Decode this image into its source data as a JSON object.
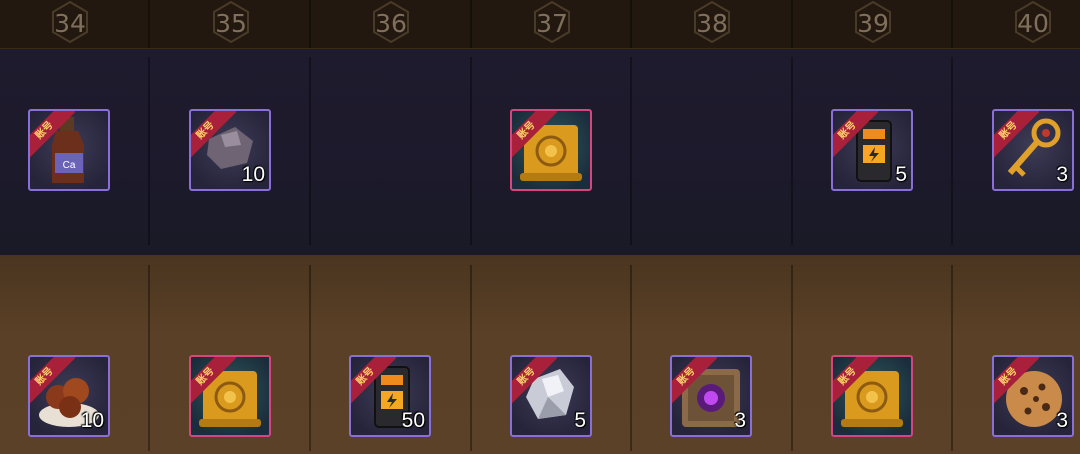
{
  "levels": [
    "34",
    "35",
    "36",
    "37",
    "38",
    "39",
    "40"
  ],
  "ribbon_text": "账号",
  "free_row": [
    {
      "col": 0,
      "icon": "soda-bottle-icon",
      "quantity": ""
    },
    {
      "col": 1,
      "icon": "ore-chunk-icon",
      "quantity": "10"
    },
    {
      "col": 3,
      "icon": "gold-scroll-icon",
      "quantity": ""
    },
    {
      "col": 5,
      "icon": "battery-device-icon",
      "quantity": "5"
    },
    {
      "col": 6,
      "icon": "golden-key-icon",
      "quantity": "3"
    }
  ],
  "paid_row": [
    {
      "col": 0,
      "icon": "meat-platter-icon",
      "quantity": "10"
    },
    {
      "col": 1,
      "icon": "gold-scroll-icon",
      "quantity": ""
    },
    {
      "col": 2,
      "icon": "battery-device-icon",
      "quantity": "50"
    },
    {
      "col": 3,
      "icon": "crystal-gem-icon",
      "quantity": "5"
    },
    {
      "col": 4,
      "icon": "portal-tablet-icon",
      "quantity": "3"
    },
    {
      "col": 5,
      "icon": "gold-scroll-icon",
      "quantity": ""
    },
    {
      "col": 6,
      "icon": "cookie-icon",
      "quantity": "3"
    }
  ],
  "colors": {
    "free_row_bg": "#1f1b2e",
    "paid_row_bg": "#5a4026",
    "item_border_purple": "#8a6fd8",
    "item_border_pink": "#d6457e",
    "ribbon": "#a8203a"
  }
}
